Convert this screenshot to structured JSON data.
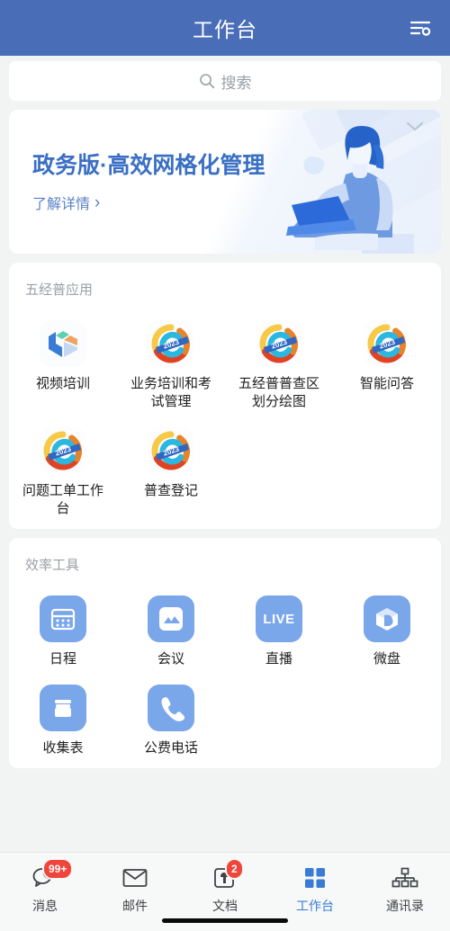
{
  "header": {
    "title": "工作台",
    "action_icon": "settings-list-icon"
  },
  "search": {
    "placeholder": "搜索",
    "icon": "search-icon"
  },
  "banner": {
    "title": "政务版·高效网格化管理",
    "link_label": "了解详情",
    "link_arrow": "›",
    "collapse_icon": "chevron-down-icon",
    "illustration": "woman-with-laptop-illustration",
    "title_color": "#3a6fc4"
  },
  "sections": [
    {
      "title": "五经普应用",
      "apps": [
        {
          "label": "视频培训",
          "icon": "hexagon-u-logo-icon"
        },
        {
          "label": "业务培训和考试管理",
          "icon": "census-2023-logo-icon"
        },
        {
          "label": "五经普普查区划分绘图",
          "icon": "census-2023-logo-icon"
        },
        {
          "label": "智能问答",
          "icon": "census-2023-logo-icon"
        },
        {
          "label": "问题工单工作台",
          "icon": "census-2023-logo-icon"
        },
        {
          "label": "普查登记",
          "icon": "census-2023-logo-icon"
        }
      ]
    },
    {
      "title": "效率工具",
      "apps": [
        {
          "label": "日程",
          "icon": "calendar-icon"
        },
        {
          "label": "会议",
          "icon": "meeting-icon"
        },
        {
          "label": "直播",
          "icon": "live-icon",
          "text": "LIVE"
        },
        {
          "label": "微盘",
          "icon": "cube-drive-icon"
        },
        {
          "label": "收集表",
          "icon": "archive-box-icon"
        },
        {
          "label": "公费电话",
          "icon": "phone-icon"
        }
      ]
    }
  ],
  "bottom_nav": {
    "active": "工作台",
    "items": [
      {
        "label": "消息",
        "icon": "chat-bubbles-icon",
        "badge": "99+"
      },
      {
        "label": "邮件",
        "icon": "envelope-icon",
        "badge": ""
      },
      {
        "label": "文档",
        "icon": "document-pen-icon",
        "badge": "2"
      },
      {
        "label": "工作台",
        "icon": "grid-squares-icon",
        "badge": ""
      },
      {
        "label": "通讯录",
        "icon": "org-chart-icon",
        "badge": ""
      }
    ]
  },
  "theme": {
    "header_blue": "#4a6db8",
    "accent_blue": "#3a7bd5",
    "tool_icon_blue": "#7aa6ea",
    "badge_red": "#f0453a",
    "page_bg": "#f1f4f3"
  }
}
